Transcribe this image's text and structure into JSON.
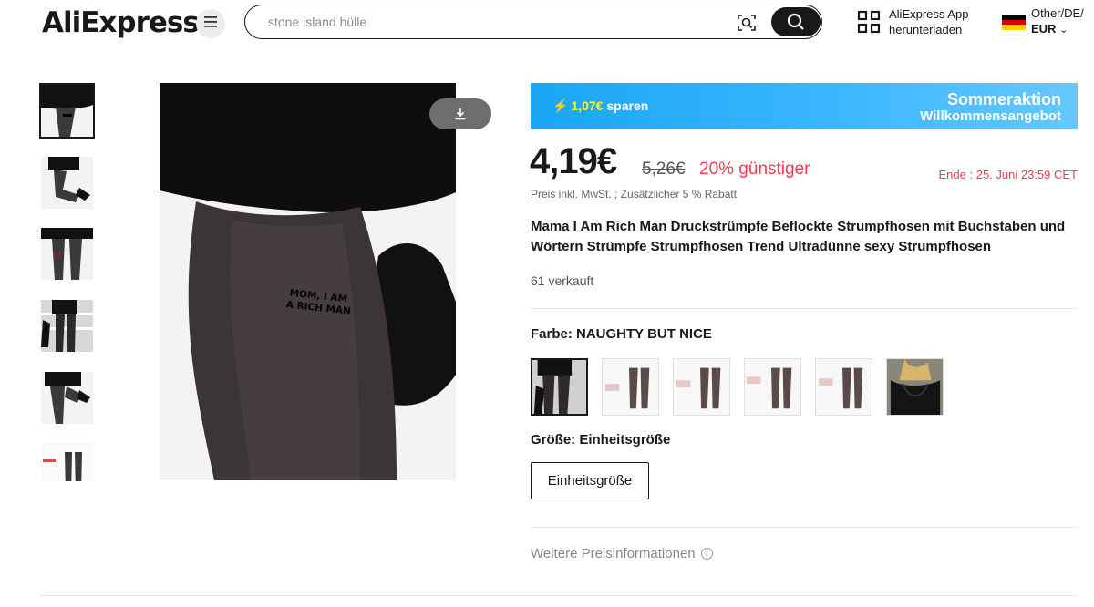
{
  "header": {
    "logo_text": "AliExpress",
    "search_placeholder": "stone island hülle",
    "app_download_line1": "AliExpress App",
    "app_download_line2": "herunterladen",
    "locale_line1": "Other/DE/",
    "locale_currency": "EUR"
  },
  "gallery": {
    "thumbnail_count": 6,
    "active_index": 0,
    "main_image_caption_line1": "MOM, I AM",
    "main_image_caption_line2": "A RICH MAN"
  },
  "promo": {
    "save_amount": "1,07€",
    "save_word": "sparen",
    "title": "Sommeraktion",
    "subtitle": "Willkommensangebot"
  },
  "pricing": {
    "price": "4,19€",
    "old_price": "5,26€",
    "discount": "20% günstiger",
    "ends": "Ende : 25. Juni 23:59 CET",
    "tax_note": "Preis inkl. MwSt. ; Zusätzlicher 5 % Rabatt"
  },
  "product": {
    "title": "Mama I Am Rich Man Druckstrümpfe Beflockte Strumpfhosen mit Buchstaben und Wörtern Strümpfe Strumpfhosen Trend Ultradünne sexy Strumpfhosen",
    "sold": "61 verkauft"
  },
  "color": {
    "label": "Farbe: NAUGHTY BUT NICE",
    "swatch_count": 6,
    "selected_index": 0
  },
  "size": {
    "label": "Größe: Einheitsgröße",
    "option": "Einheitsgröße"
  },
  "more_price_info": "Weitere Preisinformationen",
  "colors": {
    "accent_red": "#fd384f",
    "promo_blue": "#1aa6f5",
    "promo_yellow": "#fff41f",
    "text_dark": "#191919"
  }
}
